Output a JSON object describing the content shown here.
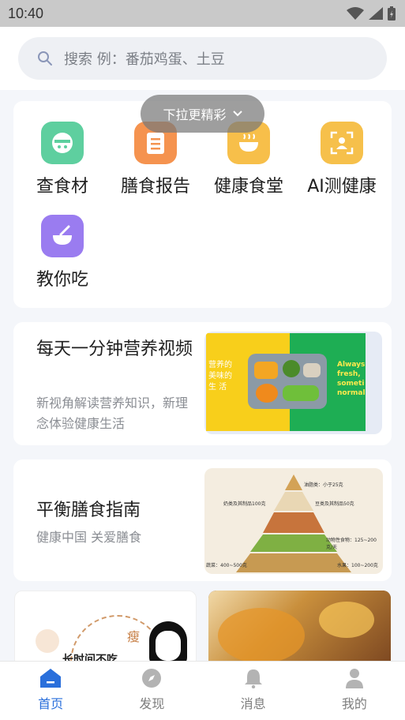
{
  "status_bar": {
    "time": "10:40"
  },
  "search": {
    "placeholder": "搜索 例：番茄鸡蛋、土豆"
  },
  "pull_hint": {
    "label": "下拉更精彩"
  },
  "grid": {
    "items": [
      {
        "label": "查食材",
        "icon": "ingredient-icon",
        "color": "#5ecf9f"
      },
      {
        "label": "膳食报告",
        "icon": "report-icon",
        "color": "#f5934f"
      },
      {
        "label": "健康食堂",
        "icon": "canteen-icon",
        "color": "#f7bf4a"
      },
      {
        "label": "AI测健康",
        "icon": "ai-scan-icon",
        "color": "#f6c04b"
      },
      {
        "label": "教你吃",
        "icon": "bowl-icon",
        "color": "#9a7cf0"
      }
    ]
  },
  "articles": [
    {
      "title": "每天一分钟营养视频",
      "desc": "新视角解读营养知识，新理念体验健康生活",
      "thumb_text": "营养的 美味的 生 活",
      "thumb_text_right": "Always fresh, someti normal"
    },
    {
      "title": "平衡膳食指南",
      "desc": "健康中国 关爱膳食",
      "pyramid_labels": [
        "油脂类：小于25克",
        "奶类及其制品100克",
        "豆类及其制品50克",
        "动物性食物：125~200克/天",
        "蔬菜：400~500克",
        "水果：100~200克"
      ]
    }
  ],
  "bottom_cards": [
    {
      "text": "长时间不吃",
      "char": "瘦"
    }
  ],
  "tabbar": {
    "items": [
      {
        "label": "首页",
        "icon": "home-icon",
        "active": true
      },
      {
        "label": "发现",
        "icon": "compass-icon",
        "active": false
      },
      {
        "label": "消息",
        "icon": "bell-icon",
        "active": false
      },
      {
        "label": "我的",
        "icon": "user-icon",
        "active": false
      }
    ]
  },
  "colors": {
    "accent": "#2a6fdb",
    "background": "#f4f6fa"
  }
}
